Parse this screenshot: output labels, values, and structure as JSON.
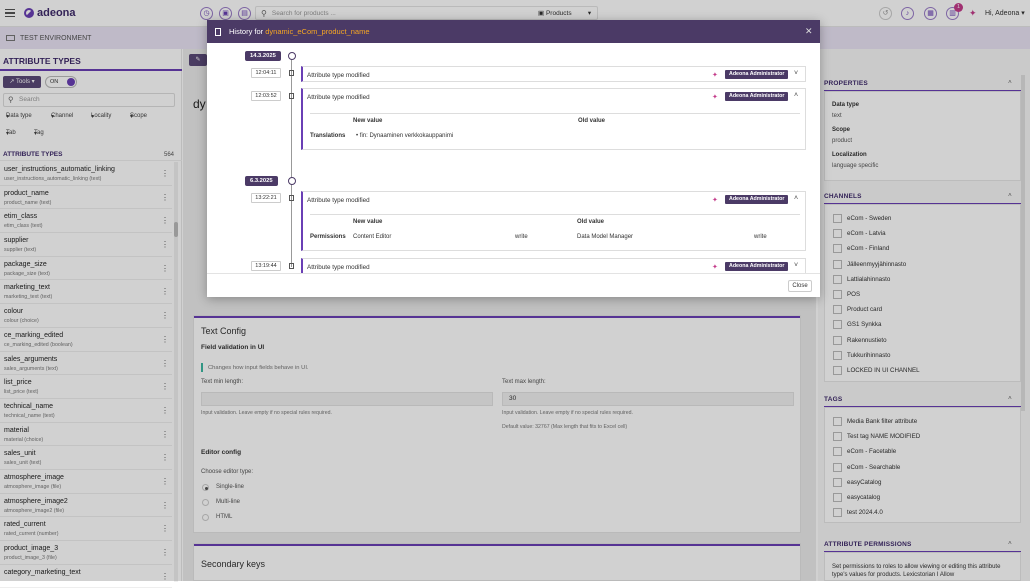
{
  "topbar": {
    "logo": "adeona",
    "search_placeholder": "Search for products ...",
    "search_scope": "Products",
    "notification_count": "1",
    "user_greeting": "Hi, Adeona"
  },
  "env": {
    "label": "TEST ENVIRONMENT"
  },
  "left": {
    "title": "ATTRIBUTE TYPES",
    "tools_label": "Tools",
    "toggle_label": "ON",
    "search_placeholder": "Search",
    "filters": [
      "Data type",
      "Channel",
      "Locality",
      "Scope",
      "Tab",
      "Tag"
    ],
    "list_header": "ATTRIBUTE TYPES",
    "list_count": "564",
    "items": [
      {
        "name": "user_instructions_automatic_linking",
        "sub": "user_instructions_automatic_linking (text)"
      },
      {
        "name": "product_name",
        "sub": "product_name (text)"
      },
      {
        "name": "etim_class",
        "sub": "etim_class (text)"
      },
      {
        "name": "supplier",
        "sub": "supplier (text)"
      },
      {
        "name": "package_size",
        "sub": "package_size (text)"
      },
      {
        "name": "marketing_text",
        "sub": "marketing_text (text)"
      },
      {
        "name": "colour",
        "sub": "colour (choice)"
      },
      {
        "name": "ce_marking_edited",
        "sub": "ce_marking_edited (boolean)"
      },
      {
        "name": "sales_arguments",
        "sub": "sales_arguments (text)"
      },
      {
        "name": "list_price",
        "sub": "list_price (text)"
      },
      {
        "name": "technical_name",
        "sub": "technical_name (text)"
      },
      {
        "name": "material",
        "sub": "material (choice)"
      },
      {
        "name": "sales_unit",
        "sub": "sales_unit (text)"
      },
      {
        "name": "atmosphere_image",
        "sub": "atmosphere_image (file)"
      },
      {
        "name": "atmosphere_image2",
        "sub": "atmosphere_image2 (file)"
      },
      {
        "name": "rated_current",
        "sub": "rated_current (number)"
      },
      {
        "name": "product_image_3",
        "sub": "product_image_3 (file)"
      },
      {
        "name": "category_marketing_text",
        "sub": ""
      }
    ]
  },
  "main": {
    "bg_title": "dy",
    "text_config": {
      "title": "Text Config",
      "field_validation": "Field validation in UI",
      "info": "Changes how input fields behave in UI.",
      "min_label": "Text min length:",
      "max_label": "Text max length:",
      "max_value": "30",
      "help_min": "Input validation. Leave empty if no special rules required.",
      "help_max": "Input validation. Leave empty if no special rules required.",
      "default_max": "Default value: 32767 (Max length that fits to Excel cell)",
      "editor_config": "Editor config",
      "choose_type": "Choose editor type:",
      "options": [
        "Single-line",
        "Multi-line",
        "HTML"
      ]
    },
    "secondary_keys": "Secondary keys"
  },
  "right": {
    "properties_title": "PROPERTIES",
    "data_type_label": "Data type",
    "data_type_value": "text",
    "scope_label": "Scope",
    "scope_value": "product",
    "localization_label": "Localization",
    "localization_value": "language specific",
    "channels_title": "CHANNELS",
    "channels": [
      "eCom - Sweden",
      "eCom - Latvia",
      "eCom - Finland",
      "Jälleenmyyjähinnasto",
      "Lattialahinnasto",
      "POS",
      "Product card",
      "GS1 Synkka",
      "Rakennustieto",
      "Tukkurihinnasto",
      "LOCKED IN UI CHANNEL"
    ],
    "tags_title": "TAGS",
    "tags": [
      "Media Bank filter attribute",
      "Test tag NAME MODIFIED",
      "eCom - Facetable",
      "eCom - Searchable",
      "easyCatalog",
      "easycatalog",
      "test 2024.4.0"
    ],
    "permissions_title": "ATTRIBUTE PERMISSIONS",
    "permissions_text": "Set permissions to roles to allow viewing or editing this attribute type's values for products. Lexicstorian I Allow"
  },
  "modal": {
    "title_prefix": "History for ",
    "title_name": "dynamic_eCom_product_name",
    "close_label": "Close",
    "admin_label": "Adeona Administrator",
    "events": [
      {
        "date": "14.3.2025",
        "time": "12:04:11",
        "text": "Attribute type modified",
        "expanded": false
      },
      {
        "date": "",
        "time": "12:03:52",
        "text": "Attribute type modified",
        "expanded": true,
        "table": {
          "new_header": "New value",
          "old_header": "Old value",
          "row_label": "Translations",
          "new_value": "fin: Dynaaminen verkkokauppanimi",
          "old_value": ""
        }
      },
      {
        "date": "6.3.2025",
        "time": "13:22:21",
        "text": "Attribute type modified",
        "expanded": true,
        "table": {
          "new_header": "New value",
          "old_header": "Old value",
          "row_label": "Permissions",
          "new_value": "Content Editor",
          "new_perm": "write",
          "old_value": "Data Model Manager",
          "old_perm": "write"
        }
      },
      {
        "date": "",
        "time": "13:19:44",
        "text": "Attribute type modified",
        "expanded": false
      }
    ]
  }
}
